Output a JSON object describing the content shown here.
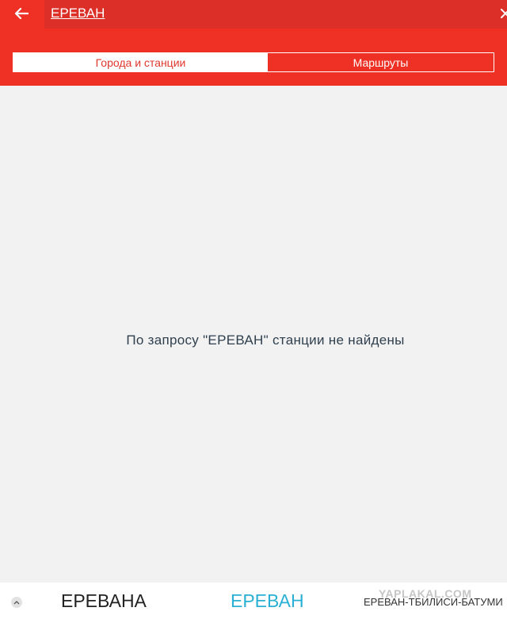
{
  "search": {
    "query": "ЕРЕВАН"
  },
  "tabs": [
    {
      "label": "Города и станции",
      "active": true
    },
    {
      "label": "Маршруты",
      "active": false
    }
  ],
  "result": {
    "empty_message": "По запросу \"ЕРЕВАН\" станции не найдены"
  },
  "keyboard_suggestions": [
    "ЕРЕВАНА",
    "ЕРЕВАН",
    "ЕРЕВАН-ТБИЛИСИ-БАТУМИ"
  ],
  "watermark": "YAPLAKAL.COM",
  "colors": {
    "accent": "#ee3124",
    "search_field": "#db2f28",
    "background": "#f2f2f2",
    "message_text": "#2f3f4e",
    "highlight_suggestion": "#2ab0d4"
  },
  "icons": {
    "back": "arrow-left-icon",
    "clear": "close-icon",
    "collapse": "chevron-up-icon"
  }
}
